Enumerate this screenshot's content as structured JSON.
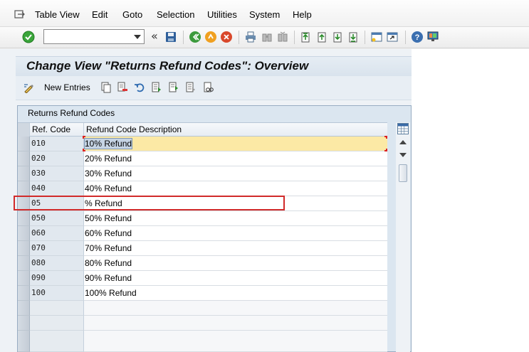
{
  "menu": {
    "items": [
      "Table View",
      "Edit",
      "Goto",
      "Selection",
      "Utilities",
      "System",
      "Help"
    ]
  },
  "toolbar": {
    "command_value": "",
    "icons": [
      "enter-icon",
      "save-icon",
      "back-icon",
      "exit-icon",
      "cancel-icon",
      "print-icon",
      "find-icon",
      "find-next-icon",
      "first-page-icon",
      "previous-page-icon",
      "next-page-icon",
      "last-page-icon",
      "create-session-icon",
      "shortcut-icon",
      "help-icon",
      "customize-layout-icon"
    ]
  },
  "title": "Change View \"Returns Refund Codes\": Overview",
  "app_toolbar": {
    "new_entries_label": "New Entries"
  },
  "table": {
    "title": "Returns Refund Codes",
    "columns": [
      "Ref. Code",
      "Refund Code Description"
    ],
    "rows": [
      {
        "code": "010",
        "desc": "10% Refund"
      },
      {
        "code": "020",
        "desc": "20% Refund"
      },
      {
        "code": "030",
        "desc": "30% Refund"
      },
      {
        "code": "040",
        "desc": "40% Refund"
      },
      {
        "code": "05",
        "desc": "% Refund"
      },
      {
        "code": "050",
        "desc": "50% Refund"
      },
      {
        "code": "060",
        "desc": "60% Refund"
      },
      {
        "code": "070",
        "desc": "70% Refund"
      },
      {
        "code": "080",
        "desc": "80% Refund"
      },
      {
        "code": "090",
        "desc": "90% Refund"
      },
      {
        "code": "100",
        "desc": "100% Refund"
      }
    ]
  },
  "colors": {
    "highlight": "#d12a2a",
    "active_row": "#fce9a5",
    "enter_green": "#3aa53a"
  }
}
